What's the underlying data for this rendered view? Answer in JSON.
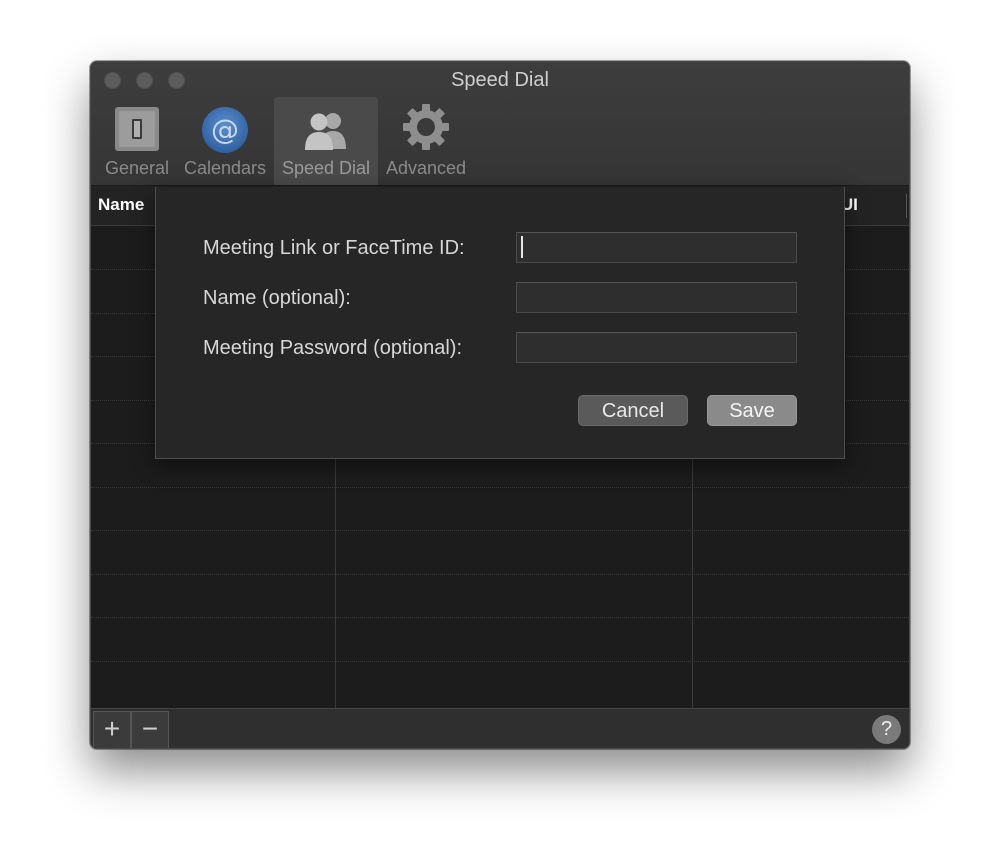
{
  "window": {
    "title": "Speed Dial"
  },
  "toolbar": {
    "tabs": [
      {
        "label": "General",
        "icon": "switch-icon"
      },
      {
        "label": "Calendars",
        "icon": "at-sign-icon"
      },
      {
        "label": "Speed Dial",
        "icon": "people-icon",
        "selected": true
      },
      {
        "label": "Advanced",
        "icon": "gear-icon"
      }
    ]
  },
  "table": {
    "columns": [
      "Name",
      "st UI"
    ]
  },
  "sheet": {
    "fields": [
      {
        "label": "Meeting Link or FaceTime ID:",
        "value": "",
        "focused": true
      },
      {
        "label": "Name (optional):",
        "value": ""
      },
      {
        "label": "Meeting Password (optional):",
        "value": ""
      }
    ],
    "cancel_label": "Cancel",
    "save_label": "Save"
  },
  "bottombar": {
    "add_label": "+",
    "remove_label": "−",
    "help_label": "?"
  },
  "colors": {
    "window_bg": "#1e1e1e",
    "titlebar_bg": "#3a3a3a",
    "sheet_bg": "#262626",
    "selected_tab_bg": "#4a4a4a"
  }
}
